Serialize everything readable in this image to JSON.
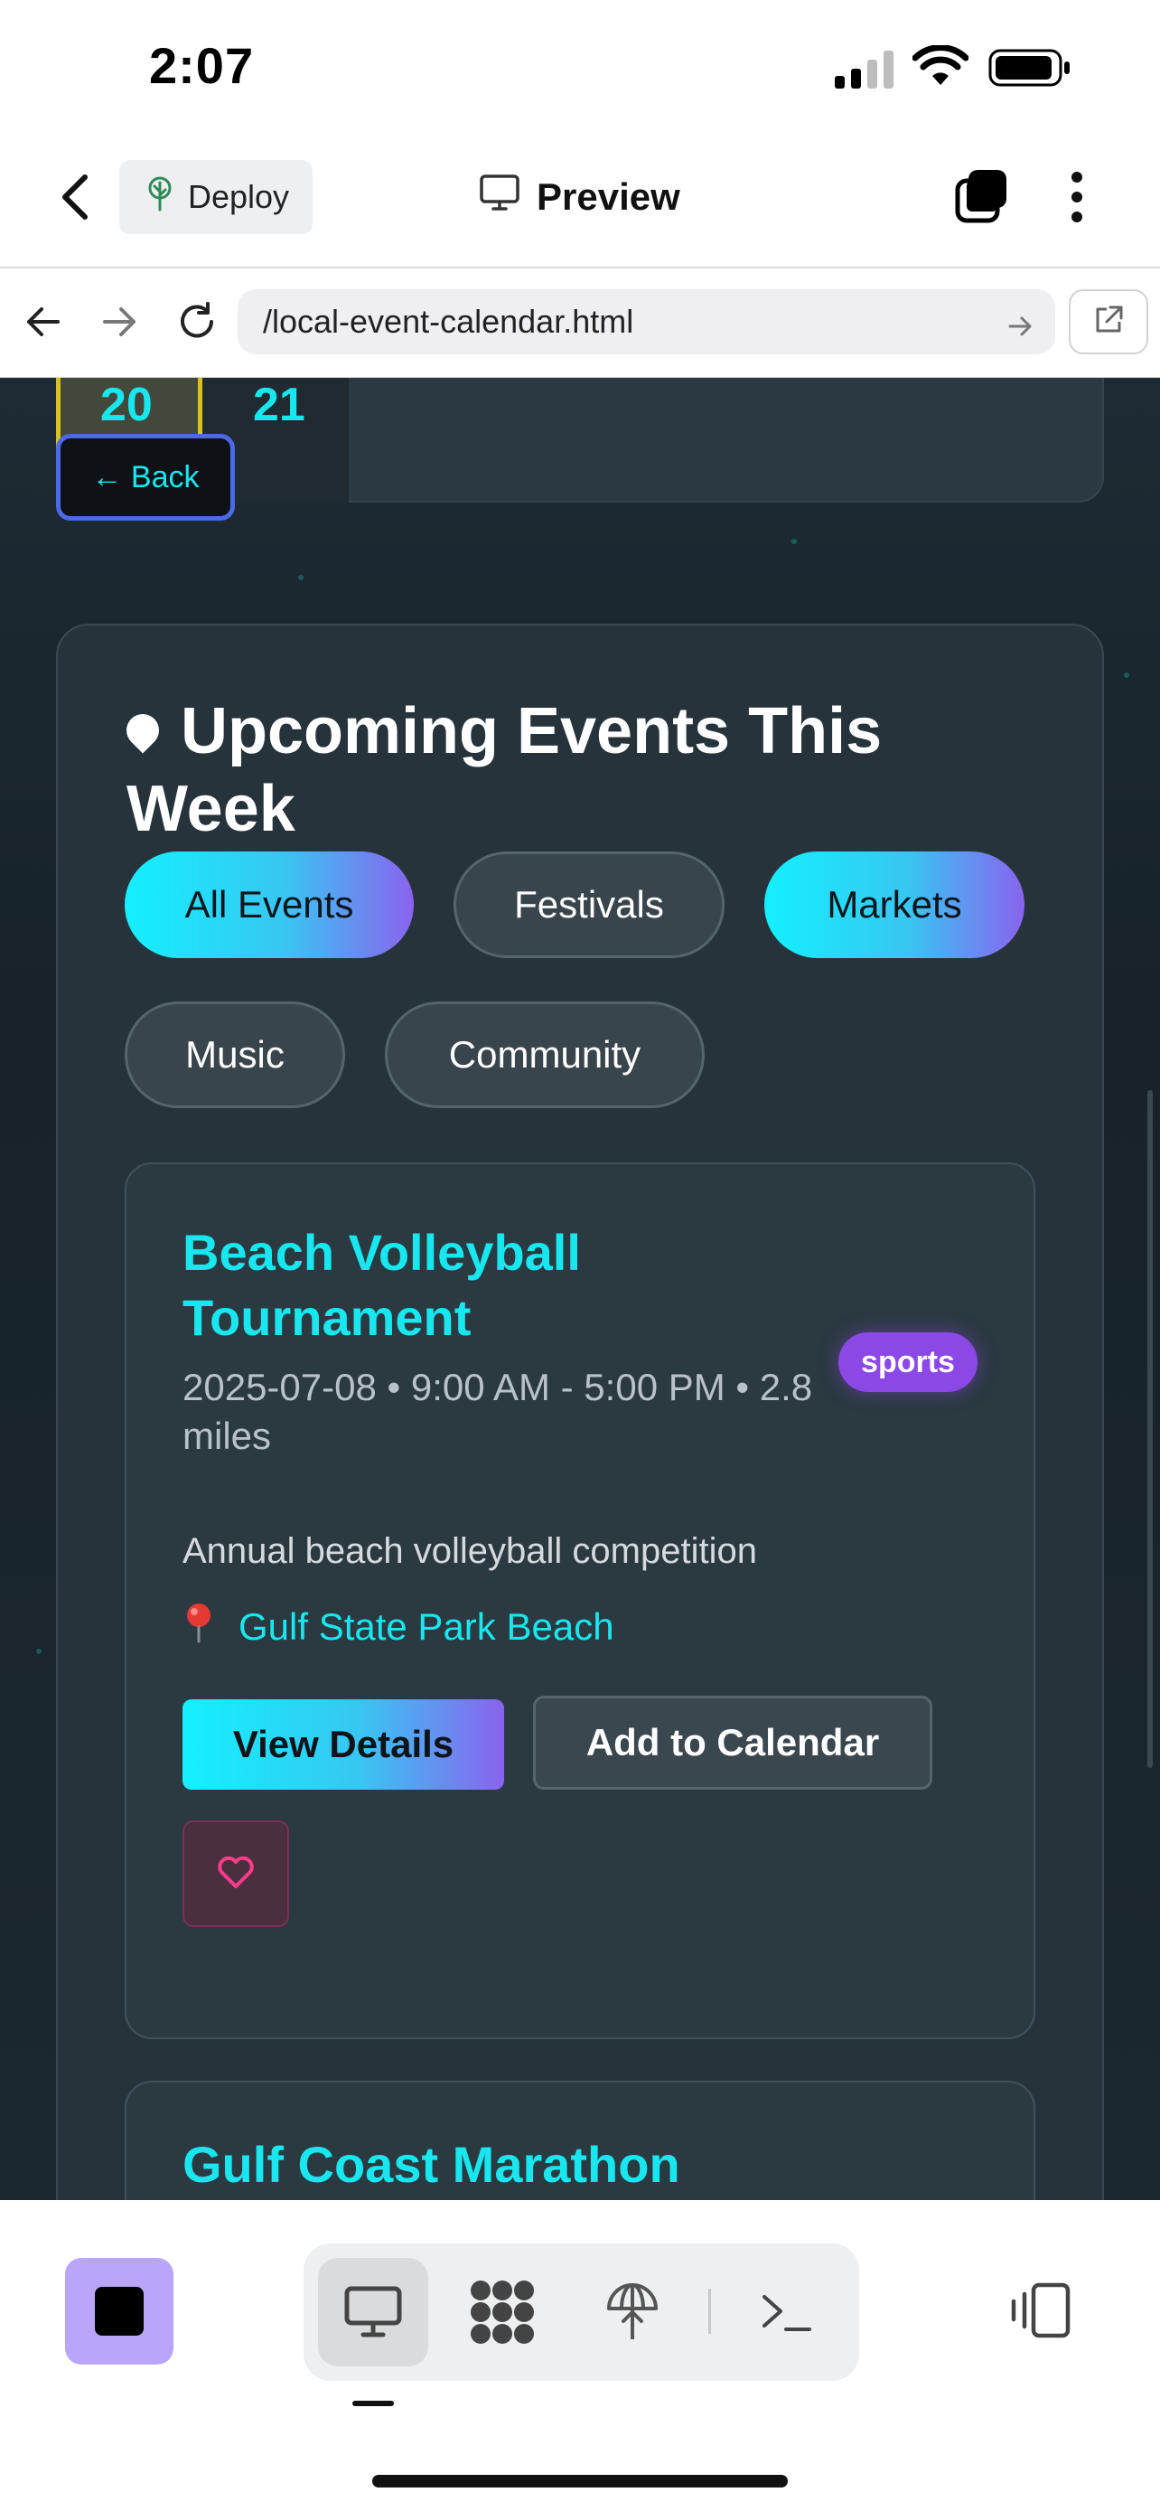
{
  "status_bar": {
    "time": "2:07"
  },
  "header": {
    "deploy_label": "Deploy",
    "preview_label": "Preview"
  },
  "browser": {
    "url": "/local-event-calendar.html"
  },
  "calendar": {
    "day_20": "20",
    "day_21": "21",
    "back_label": "← Back"
  },
  "events_section": {
    "title": "Upcoming Events This Week",
    "filters": [
      {
        "label": "All Events",
        "active": true
      },
      {
        "label": "Festivals",
        "active": false
      },
      {
        "label": "Markets",
        "active": true
      },
      {
        "label": "Music",
        "active": false
      },
      {
        "label": "Community",
        "active": false
      }
    ],
    "events": [
      {
        "title": "Beach Volleyball Tournament",
        "category": "sports",
        "meta": "2025-07-08 • 9:00 AM - 5:00 PM • 2.8 miles",
        "description": "Annual beach volleyball competition",
        "location": "Gulf State Park Beach",
        "view_label": "View Details",
        "add_label": "Add to Calendar"
      },
      {
        "title": "Gulf Coast Marathon"
      }
    ]
  },
  "colors": {
    "accent": "#18e7ef",
    "badge": "#8b48e6",
    "stop_button": "#b9a6fb",
    "highlight_border": "#d9c11c"
  },
  "icons": [
    "back-chevron-icon",
    "tree-icon",
    "monitor-icon",
    "tabs-icon",
    "more-icon",
    "arrow-left-icon",
    "arrow-right-icon",
    "reload-icon",
    "go-icon",
    "external-link-icon",
    "pin-icon",
    "location-pin-icon",
    "heart-icon",
    "stop-icon",
    "grid-icon",
    "umbrella-icon",
    "terminal-icon",
    "device-icon"
  ]
}
